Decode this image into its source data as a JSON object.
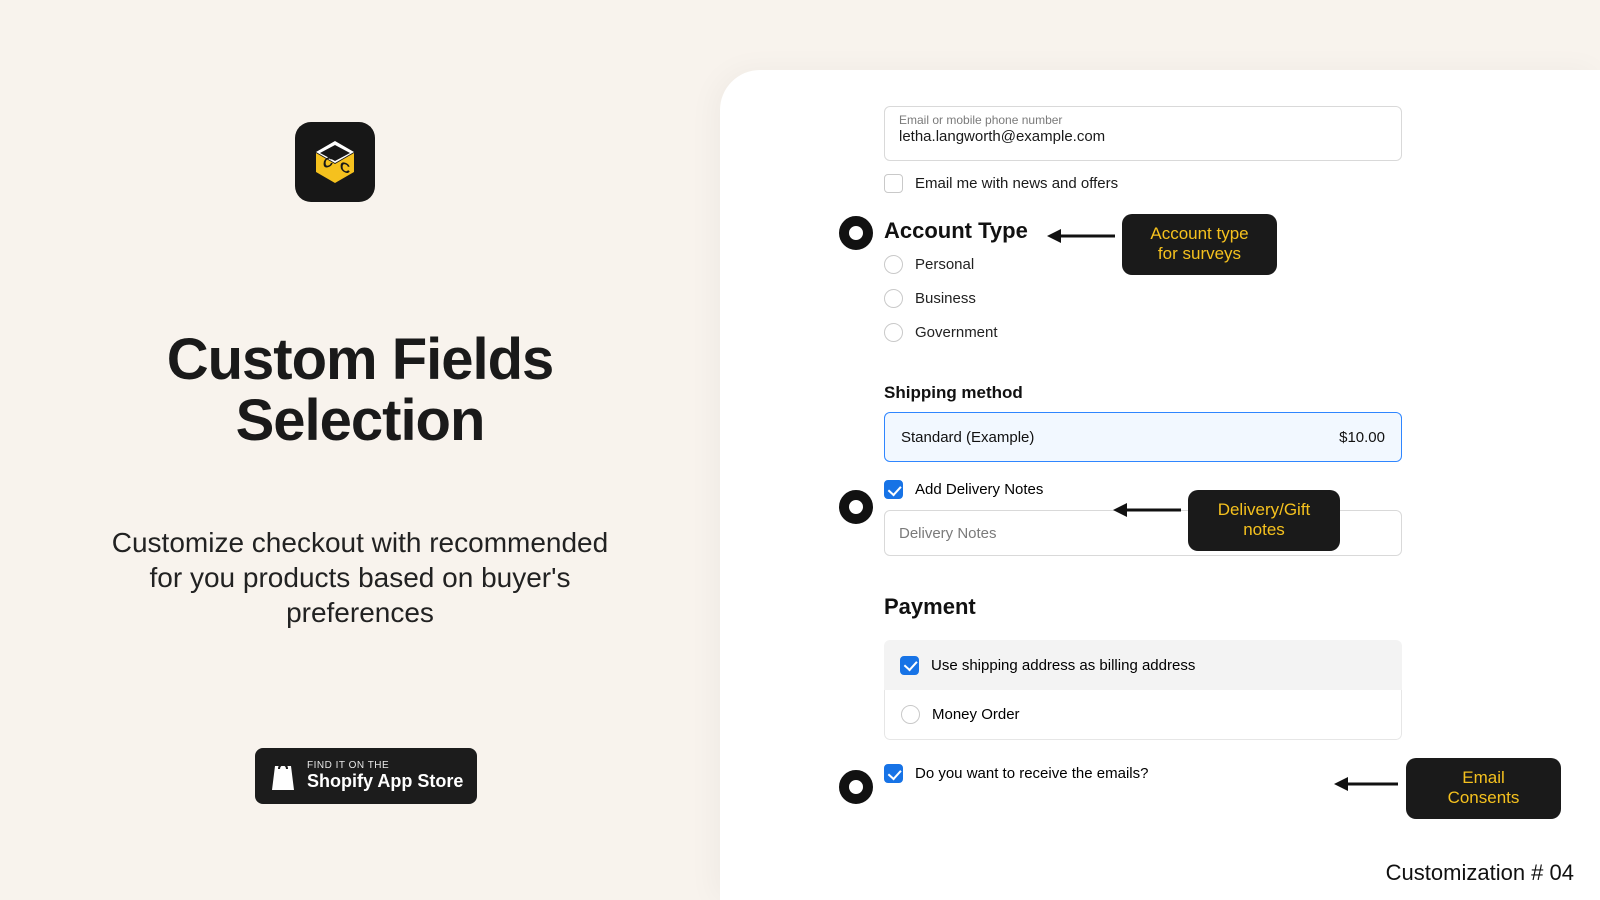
{
  "left": {
    "title": "Custom Fields Selection",
    "subtitle": "Customize checkout with recommended for you products based on buyer's preferences"
  },
  "shopify": {
    "line1": "FIND IT ON THE",
    "line2": "Shopify App Store"
  },
  "form": {
    "email_label": "Email or mobile phone number",
    "email_value": "letha.langworth@example.com",
    "news_label": "Email me with news and offers",
    "account_type_title": "Account Type",
    "account_types": {
      "opt1": "Personal",
      "opt2": "Business",
      "opt3": "Government"
    },
    "shipping_title": "Shipping method",
    "shipping_option": "Standard (Example)",
    "shipping_price": "$10.00",
    "delivery_checkbox": "Add Delivery Notes",
    "delivery_placeholder": "Delivery Notes",
    "payment_title": "Payment",
    "billing_same": "Use shipping address as billing address",
    "money_order": "Money Order",
    "emails_consent": "Do you want to receive the emails?"
  },
  "tooltips": {
    "account": "Account type for surveys",
    "delivery": "Delivery/Gift notes",
    "emails": "Email Consents"
  },
  "footer": "Customization # 04"
}
